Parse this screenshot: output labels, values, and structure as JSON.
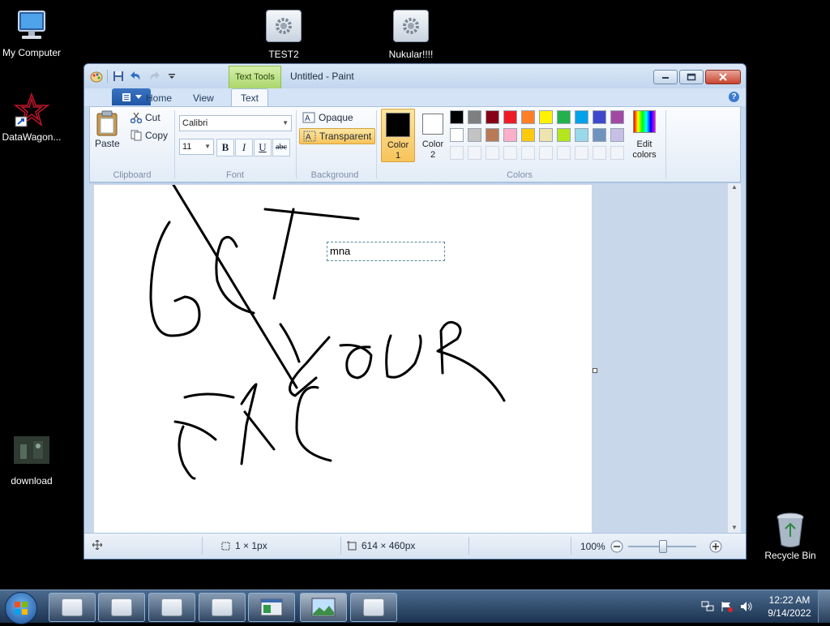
{
  "desktop": {
    "icons": [
      {
        "label": "My Computer"
      },
      {
        "label": "TEST2"
      },
      {
        "label": "Nukular!!!!"
      },
      {
        "label": "DataWagon..."
      },
      {
        "label": "download"
      },
      {
        "label": "Recycle Bin"
      }
    ]
  },
  "paint": {
    "title": "Untitled - Paint",
    "contextual_tab": "Text Tools",
    "tabs": [
      "Home",
      "View",
      "Text"
    ],
    "active_tab": "Text",
    "clipboard": {
      "paste": "Paste",
      "cut": "Cut",
      "copy": "Copy",
      "group": "Clipboard"
    },
    "font": {
      "family": "Calibri",
      "size": "11",
      "bold": "B",
      "italic": "I",
      "underline": "U",
      "strike": "abc",
      "group": "Font"
    },
    "background": {
      "opaque": "Opaque",
      "transparent": "Transparent",
      "group": "Background",
      "selected": "Transparent"
    },
    "colors": {
      "color1_label": "Color",
      "color1_num": "1",
      "color2_label": "Color",
      "color2_num": "2",
      "edit_label": "Edit",
      "edit_label2": "colors",
      "group": "Colors",
      "color1": "#000000",
      "color2": "#ffffff",
      "palette_row1": [
        "#000000",
        "#7f7f7f",
        "#880015",
        "#ed1c24",
        "#ff7f27",
        "#fff200",
        "#22b14c",
        "#00a2e8",
        "#3f48cc",
        "#a349a4"
      ],
      "palette_row2": [
        "#ffffff",
        "#c3c3c3",
        "#b97a57",
        "#ffaec9",
        "#ffc90e",
        "#efe4b0",
        "#b5e61d",
        "#99d9ea",
        "#7092be",
        "#c8bfe7"
      ]
    },
    "text_box_content": "mna",
    "status": {
      "selection": "1 × 1px",
      "canvas_size": "614 × 460px",
      "zoom": "100%"
    }
  },
  "taskbar": {
    "time": "12:22 AM",
    "date": "9/14/2022"
  }
}
